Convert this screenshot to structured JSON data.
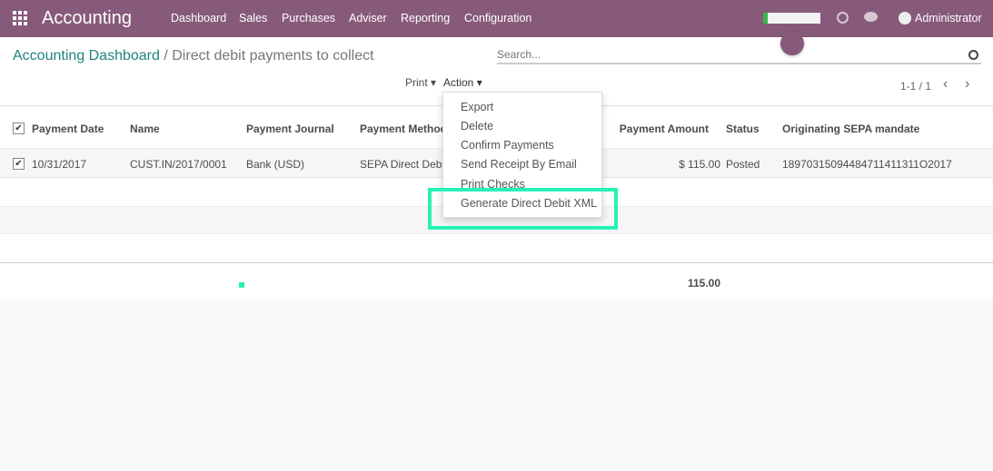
{
  "navbar": {
    "app_title": "Accounting",
    "menu": [
      "Dashboard",
      "Sales",
      "Purchases",
      "Adviser",
      "Reporting",
      "Configuration"
    ],
    "user": "Administrator",
    "bg_color": "#875a7b"
  },
  "breadcrumb": {
    "parent": "Accounting Dashboard",
    "separator": "/",
    "current": "Direct debit payments to collect"
  },
  "search": {
    "placeholder": "Search..."
  },
  "toolbar": {
    "print": "Print",
    "action": "Action",
    "pager": "1-1 / 1"
  },
  "action_menu": [
    "Export",
    "Delete",
    "Confirm Payments",
    "Send Receipt By Email",
    "Print Checks",
    "Generate Direct Debit XML"
  ],
  "highlight_color": "#27f2b6",
  "table": {
    "headers": [
      "Payment Date",
      "Name",
      "Payment Journal",
      "Payment Method",
      "Payment Amount",
      "Status",
      "Originating SEPA mandate"
    ],
    "rows": [
      {
        "date": "10/31/2017",
        "name": "CUST.IN/2017/0001",
        "journal": "Bank (USD)",
        "method": "SEPA Direct Debit",
        "amount": "$ 115.00",
        "status": "Posted",
        "mandate": "18970315094484711411311O2017"
      }
    ],
    "total": "115.00"
  }
}
